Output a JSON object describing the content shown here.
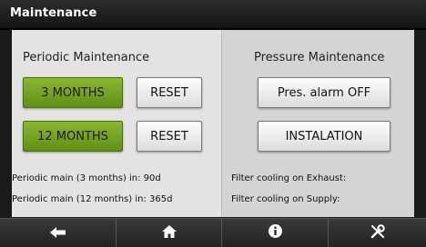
{
  "title": "Maintenance",
  "periodic": {
    "heading": "Periodic Maintenance",
    "btn_3months": "3 MONTHS",
    "btn_12months": "12 MONTHS",
    "reset_label": "RESET",
    "info_3": "Periodic main (3 months) in: 90d",
    "info_12": "Periodic main (12 months) in: 365d"
  },
  "pressure": {
    "heading": "Pressure Maintenance",
    "btn_alarm": "Pres. alarm OFF",
    "btn_install": "INSTALATION",
    "info_exhaust": "Filter cooling on Exhaust:",
    "info_supply": "Filter cooling on Supply:"
  },
  "nav": {
    "icons": [
      "back-arrow-icon",
      "home-icon",
      "info-icon",
      "tools-icon"
    ]
  },
  "colors": {
    "active_green": "#6f9f1c"
  }
}
